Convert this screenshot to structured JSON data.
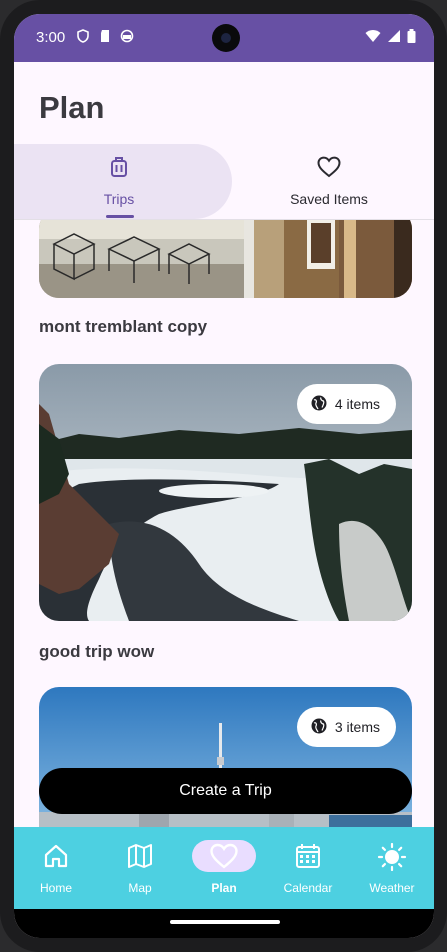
{
  "status": {
    "time": "3:00"
  },
  "header": {
    "title": "Plan"
  },
  "tabs": [
    {
      "label": "Trips",
      "icon": "luggage-icon",
      "selected": true
    },
    {
      "label": "Saved Items",
      "icon": "heart-outline-icon",
      "selected": false
    }
  ],
  "trips": [
    {
      "name": "mont tremblant copy"
    },
    {
      "name": "good trip wow",
      "items_label": "4 items"
    },
    {
      "name": "",
      "items_label": "3 items"
    }
  ],
  "actions": {
    "create_trip_label": "Create a Trip"
  },
  "nav": [
    {
      "label": "Home",
      "icon": "home-icon",
      "active": false
    },
    {
      "label": "Map",
      "icon": "map-icon",
      "active": false
    },
    {
      "label": "Plan",
      "icon": "heart-icon",
      "active": true
    },
    {
      "label": "Calendar",
      "icon": "calendar-icon",
      "active": false
    },
    {
      "label": "Weather",
      "icon": "sun-icon",
      "active": false
    }
  ],
  "colors": {
    "accent": "#6750a4",
    "nav_bg": "#4dd0e1",
    "nav_pill": "#e9ddff"
  }
}
